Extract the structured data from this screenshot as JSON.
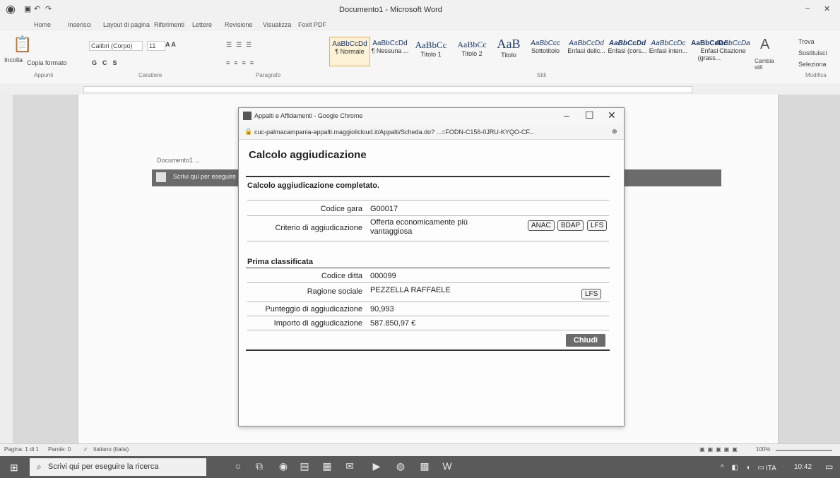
{
  "word": {
    "window_title": "Documento1 - Microsoft Word",
    "tabs": [
      "Home",
      "Inserisci",
      "Layout di pagina",
      "Riferimenti",
      "Lettere",
      "Revisione",
      "Visualizza",
      "Foxit PDF"
    ],
    "ribbon": {
      "paste_label": "Incolla",
      "copy_format": "Copia formato",
      "font_name": "Calibri (Corpo)",
      "font_size": "11",
      "group_clipboard": "Appunti",
      "group_font": "Carattere",
      "group_paragraph": "Paragrafo",
      "group_styles": "Stili",
      "group_edit": "Modifica",
      "styles": [
        {
          "sample": "AaBbCcDd",
          "name": "¶ Normale"
        },
        {
          "sample": "AaBbCcDd",
          "name": "¶ Nessuna ..."
        },
        {
          "sample": "AaBbCc",
          "name": "Titolo 1"
        },
        {
          "sample": "AaBbCc",
          "name": "Titolo 2"
        },
        {
          "sample": "AaB",
          "name": "Titolo"
        },
        {
          "sample": "AaBbCcc",
          "name": "Sottotitolo"
        },
        {
          "sample": "AaBbCcDd",
          "name": "Enfasi delic..."
        },
        {
          "sample": "AaBbCcDd",
          "name": "Enfasi (cors..."
        },
        {
          "sample": "AaBbCcDc",
          "name": "Enfasi inten..."
        },
        {
          "sample": "AaBbCcDc",
          "name": "Enfasi (grass..."
        },
        {
          "sample": "AaBbCcDa",
          "name": "Citazione"
        }
      ],
      "change_styles": "Cambia stili",
      "find": "Trova",
      "replace": "Sostituisci",
      "select": "Seleziona"
    },
    "status": {
      "page": "Pagina: 1 di 1",
      "words": "Parole: 0",
      "language": "Italiano (Italia)",
      "zoom": "100%"
    }
  },
  "inner_strip": {
    "search_text": "Scrivi qui per eseguire",
    "doc_text": "Documento1 ..."
  },
  "popup": {
    "window_title": "Appalti e Affidamenti - Google Chrome",
    "url": "cuc-palmacampania-appalti.maggiolicloud.it/Appalti/Scheda.do? ...=FODN-C156-0JRU-KYQO-CF...",
    "heading": "Calcolo aggiudicazione",
    "status_message": "Calcolo aggiudicazione completato.",
    "rows1": [
      {
        "label": "Codice gara",
        "value": "G00017"
      },
      {
        "label": "Criterio di aggiudicazione",
        "value": "Offerta economicamente più vantaggiosa"
      }
    ],
    "buttons": {
      "anac": "ANAC",
      "bdap": "BDAP",
      "lfs": "LFS",
      "lfs2": "LFS",
      "close": "Chiudi"
    },
    "section_title": "Prima classificata",
    "rows2": [
      {
        "label": "Codice ditta",
        "value": "000099"
      },
      {
        "label": "Ragione sociale",
        "value": "PEZZELLA RAFFAELE"
      },
      {
        "label": "Punteggio di aggiudicazione",
        "value": "90,993"
      },
      {
        "label": "Importo di aggiudicazione",
        "value": "587.850,97 €"
      }
    ]
  },
  "taskbar": {
    "search_placeholder": "Scrivi qui per eseguire la ricerca",
    "language": "ITA",
    "time": "10:42"
  }
}
